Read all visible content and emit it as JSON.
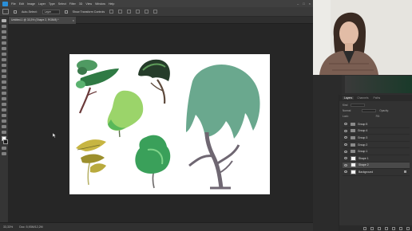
{
  "menu": {
    "items": [
      "File",
      "Edit",
      "Image",
      "Layer",
      "Type",
      "Select",
      "Filter",
      "3D",
      "View",
      "Window",
      "Help"
    ],
    "window_controls": [
      "–",
      "□",
      "×"
    ]
  },
  "options_bar": {
    "auto_select_label": "Auto-Select:",
    "auto_select_value": "Layer",
    "transform_label": "Show Transform Controls"
  },
  "document": {
    "tab_title": "Untitled-1 @ 33,3% (Shape 2, RGB/8) *",
    "tab_close": "×"
  },
  "status_bar": {
    "zoom": "33,33%",
    "doc_info": "Doc: 5,93M/12,2M"
  },
  "layers_panel": {
    "tabs": [
      "Layers",
      "Channels",
      "Paths"
    ],
    "active_tab": "Layers",
    "kind_label": "Kind",
    "mode_label": "Normal",
    "opacity_label": "Opacity:",
    "lock_label": "Lock:",
    "fill_label": "Fill:",
    "layers": [
      {
        "name": "Group 5",
        "type": "group"
      },
      {
        "name": "Group 4",
        "type": "group"
      },
      {
        "name": "Group 3",
        "type": "group"
      },
      {
        "name": "Group 2",
        "type": "group"
      },
      {
        "name": "Group 1",
        "type": "group"
      },
      {
        "name": "Shape 1",
        "type": "shape"
      },
      {
        "name": "Shape 2",
        "type": "shape",
        "selected": true
      },
      {
        "name": "Background",
        "type": "background",
        "locked": true
      }
    ]
  },
  "colors": {
    "canvas_bg": "#ffffff",
    "workspace_bg": "#262626",
    "panel_bg": "#323232",
    "tree_green_dark": "#2f6b3e",
    "tree_green_mid": "#5aa36a",
    "tree_green_light": "#8fd16a",
    "willow_green": "#6aa88e",
    "trunk_purple": "#6f6772",
    "trunk_brown": "#6b4a3a",
    "yellow_tree": "#b8a63a"
  }
}
